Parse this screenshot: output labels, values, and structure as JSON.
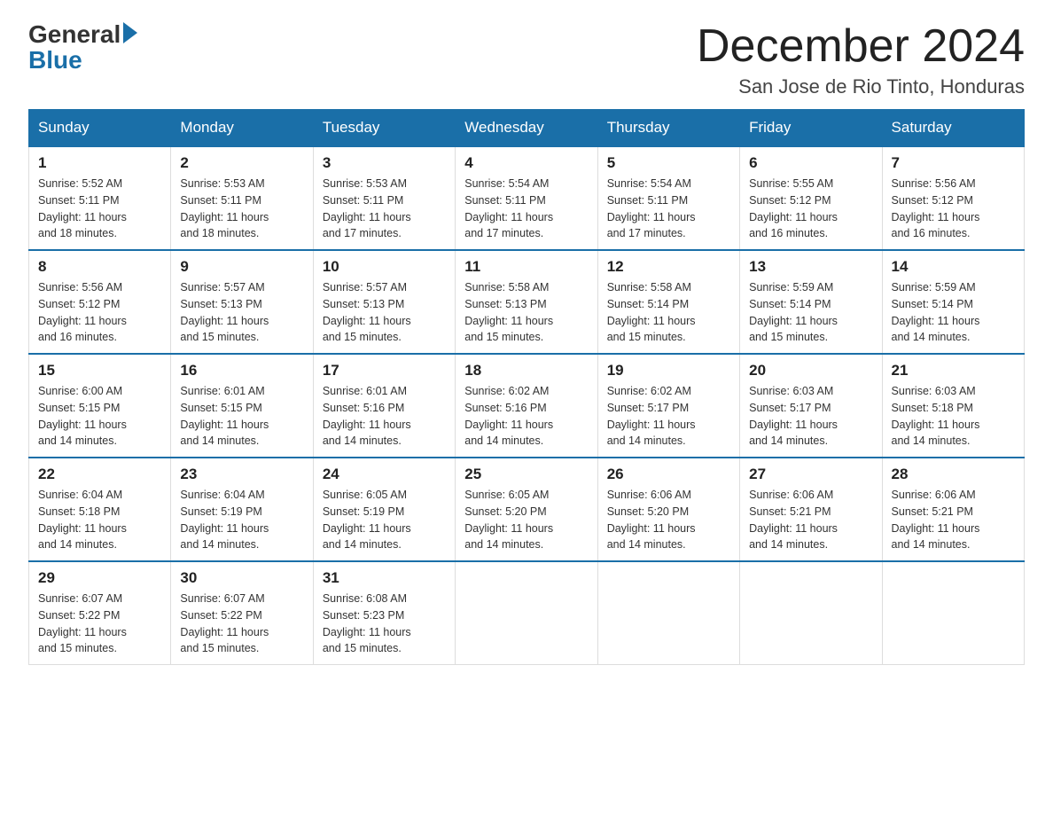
{
  "logo": {
    "text_general": "General",
    "text_blue": "Blue",
    "arrow": "▶"
  },
  "header": {
    "month_title": "December 2024",
    "location": "San Jose de Rio Tinto, Honduras"
  },
  "days_of_week": [
    "Sunday",
    "Monday",
    "Tuesday",
    "Wednesday",
    "Thursday",
    "Friday",
    "Saturday"
  ],
  "weeks": [
    [
      {
        "day": "1",
        "sunrise": "5:52 AM",
        "sunset": "5:11 PM",
        "daylight": "11 hours and 18 minutes."
      },
      {
        "day": "2",
        "sunrise": "5:53 AM",
        "sunset": "5:11 PM",
        "daylight": "11 hours and 18 minutes."
      },
      {
        "day": "3",
        "sunrise": "5:53 AM",
        "sunset": "5:11 PM",
        "daylight": "11 hours and 17 minutes."
      },
      {
        "day": "4",
        "sunrise": "5:54 AM",
        "sunset": "5:11 PM",
        "daylight": "11 hours and 17 minutes."
      },
      {
        "day": "5",
        "sunrise": "5:54 AM",
        "sunset": "5:11 PM",
        "daylight": "11 hours and 17 minutes."
      },
      {
        "day": "6",
        "sunrise": "5:55 AM",
        "sunset": "5:12 PM",
        "daylight": "11 hours and 16 minutes."
      },
      {
        "day": "7",
        "sunrise": "5:56 AM",
        "sunset": "5:12 PM",
        "daylight": "11 hours and 16 minutes."
      }
    ],
    [
      {
        "day": "8",
        "sunrise": "5:56 AM",
        "sunset": "5:12 PM",
        "daylight": "11 hours and 16 minutes."
      },
      {
        "day": "9",
        "sunrise": "5:57 AM",
        "sunset": "5:13 PM",
        "daylight": "11 hours and 15 minutes."
      },
      {
        "day": "10",
        "sunrise": "5:57 AM",
        "sunset": "5:13 PM",
        "daylight": "11 hours and 15 minutes."
      },
      {
        "day": "11",
        "sunrise": "5:58 AM",
        "sunset": "5:13 PM",
        "daylight": "11 hours and 15 minutes."
      },
      {
        "day": "12",
        "sunrise": "5:58 AM",
        "sunset": "5:14 PM",
        "daylight": "11 hours and 15 minutes."
      },
      {
        "day": "13",
        "sunrise": "5:59 AM",
        "sunset": "5:14 PM",
        "daylight": "11 hours and 15 minutes."
      },
      {
        "day": "14",
        "sunrise": "5:59 AM",
        "sunset": "5:14 PM",
        "daylight": "11 hours and 14 minutes."
      }
    ],
    [
      {
        "day": "15",
        "sunrise": "6:00 AM",
        "sunset": "5:15 PM",
        "daylight": "11 hours and 14 minutes."
      },
      {
        "day": "16",
        "sunrise": "6:01 AM",
        "sunset": "5:15 PM",
        "daylight": "11 hours and 14 minutes."
      },
      {
        "day": "17",
        "sunrise": "6:01 AM",
        "sunset": "5:16 PM",
        "daylight": "11 hours and 14 minutes."
      },
      {
        "day": "18",
        "sunrise": "6:02 AM",
        "sunset": "5:16 PM",
        "daylight": "11 hours and 14 minutes."
      },
      {
        "day": "19",
        "sunrise": "6:02 AM",
        "sunset": "5:17 PM",
        "daylight": "11 hours and 14 minutes."
      },
      {
        "day": "20",
        "sunrise": "6:03 AM",
        "sunset": "5:17 PM",
        "daylight": "11 hours and 14 minutes."
      },
      {
        "day": "21",
        "sunrise": "6:03 AM",
        "sunset": "5:18 PM",
        "daylight": "11 hours and 14 minutes."
      }
    ],
    [
      {
        "day": "22",
        "sunrise": "6:04 AM",
        "sunset": "5:18 PM",
        "daylight": "11 hours and 14 minutes."
      },
      {
        "day": "23",
        "sunrise": "6:04 AM",
        "sunset": "5:19 PM",
        "daylight": "11 hours and 14 minutes."
      },
      {
        "day": "24",
        "sunrise": "6:05 AM",
        "sunset": "5:19 PM",
        "daylight": "11 hours and 14 minutes."
      },
      {
        "day": "25",
        "sunrise": "6:05 AM",
        "sunset": "5:20 PM",
        "daylight": "11 hours and 14 minutes."
      },
      {
        "day": "26",
        "sunrise": "6:06 AM",
        "sunset": "5:20 PM",
        "daylight": "11 hours and 14 minutes."
      },
      {
        "day": "27",
        "sunrise": "6:06 AM",
        "sunset": "5:21 PM",
        "daylight": "11 hours and 14 minutes."
      },
      {
        "day": "28",
        "sunrise": "6:06 AM",
        "sunset": "5:21 PM",
        "daylight": "11 hours and 14 minutes."
      }
    ],
    [
      {
        "day": "29",
        "sunrise": "6:07 AM",
        "sunset": "5:22 PM",
        "daylight": "11 hours and 15 minutes."
      },
      {
        "day": "30",
        "sunrise": "6:07 AM",
        "sunset": "5:22 PM",
        "daylight": "11 hours and 15 minutes."
      },
      {
        "day": "31",
        "sunrise": "6:08 AM",
        "sunset": "5:23 PM",
        "daylight": "11 hours and 15 minutes."
      },
      null,
      null,
      null,
      null
    ]
  ],
  "labels": {
    "sunrise": "Sunrise:",
    "sunset": "Sunset:",
    "daylight": "Daylight:"
  }
}
